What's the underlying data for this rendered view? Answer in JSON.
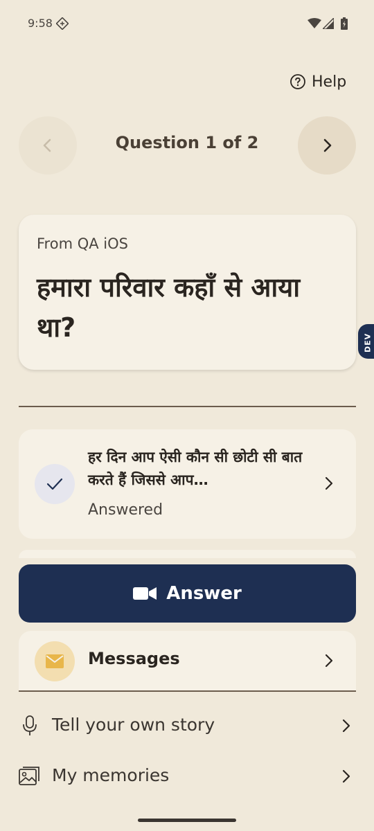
{
  "status_bar": {
    "time": "9:58"
  },
  "help": {
    "label": "Help"
  },
  "question_nav": {
    "counter": "Question 1 of 2"
  },
  "question_card": {
    "source": "From QA iOS",
    "text": "हमारा परिवार कहाँ से आया था?"
  },
  "dev_badge": {
    "label": "DEV"
  },
  "answered_item": {
    "question": "हर दिन आप ऐसी कौन सी छोटी सी बात करते हैं जिससे आप…",
    "status": "Answered"
  },
  "answer_button": {
    "label": "Answer"
  },
  "messages": {
    "label": "Messages"
  },
  "list": {
    "story_label": "Tell your own story",
    "memories_label": "My memories"
  },
  "colors": {
    "background": "#f0e9da",
    "card": "#f6f1e6",
    "primary": "#1e2f52",
    "mail_accent": "#e8b64a"
  }
}
